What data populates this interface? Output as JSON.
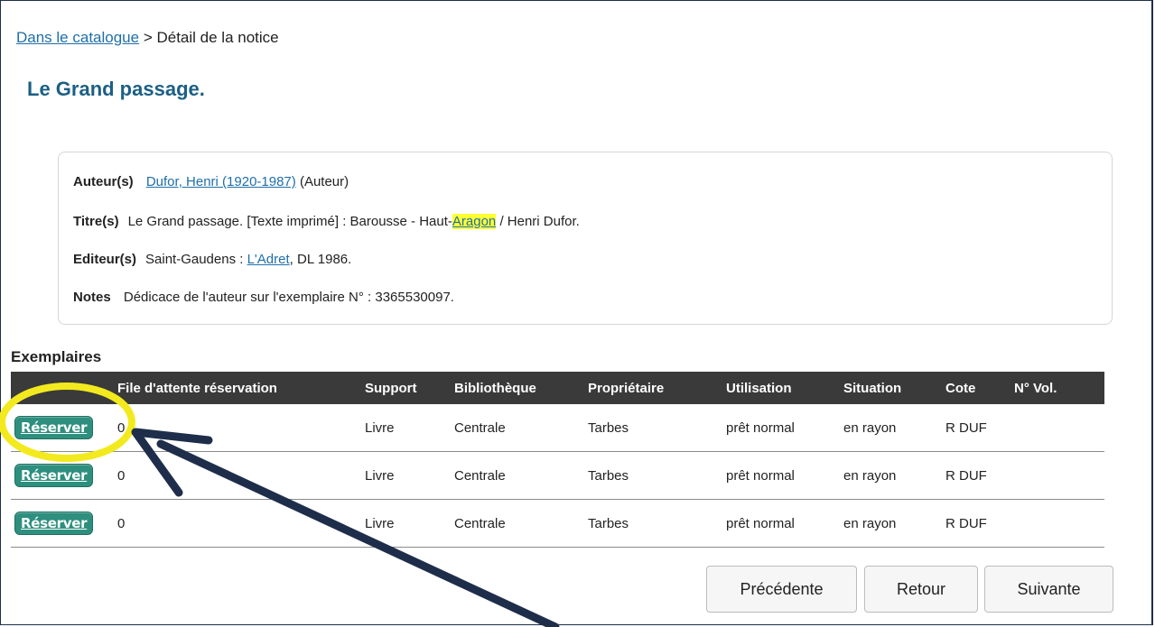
{
  "breadcrumb": {
    "link": "Dans le catalogue",
    "separator": " > ",
    "current": "Détail de la notice"
  },
  "title": "Le Grand passage.",
  "notice": {
    "author_label": "Auteur(s)",
    "author_link": "Dufor, Henri (1920-1987)",
    "author_role": "(Auteur)",
    "title_label": "Titre(s)",
    "title_before": "Le Grand passage. [Texte imprimé] : Barousse - Haut-",
    "title_highlight": "Aragon",
    "title_after": " / Henri Dufor.",
    "publisher_label": "Editeur(s)",
    "publisher_before": "Saint-Gaudens : ",
    "publisher_link": "L'Adret",
    "publisher_after": ", DL 1986.",
    "notes_label": "Notes",
    "notes_value": "Dédicace de l'auteur sur l'exemplaire N° : 3365530097."
  },
  "copies": {
    "section_title": "Exemplaires",
    "columns": [
      "",
      "File d'attente réservation",
      "Support",
      "Bibliothèque",
      "Propriétaire",
      "Utilisation",
      "Situation",
      "Cote",
      "N° Vol."
    ],
    "reserve_label": "Réserver",
    "rows": [
      {
        "queue": "0",
        "support": "Livre",
        "library": "Centrale",
        "owner": "Tarbes",
        "usage": "prêt normal",
        "location": "en rayon",
        "call": "R DUF",
        "vol": ""
      },
      {
        "queue": "0",
        "support": "Livre",
        "library": "Centrale",
        "owner": "Tarbes",
        "usage": "prêt normal",
        "location": "en rayon",
        "call": "R DUF",
        "vol": ""
      },
      {
        "queue": "0",
        "support": "Livre",
        "library": "Centrale",
        "owner": "Tarbes",
        "usage": "prêt normal",
        "location": "en rayon",
        "call": "R DUF",
        "vol": ""
      }
    ]
  },
  "nav": {
    "previous": "Précédente",
    "back": "Retour",
    "next": "Suivante"
  },
  "colors": {
    "title": "#1b5f85",
    "link": "#1f6fa8",
    "reserve_button": "#2e8f7e",
    "highlight_circle": "#f2ea1e",
    "arrow": "#1e2e4a"
  }
}
